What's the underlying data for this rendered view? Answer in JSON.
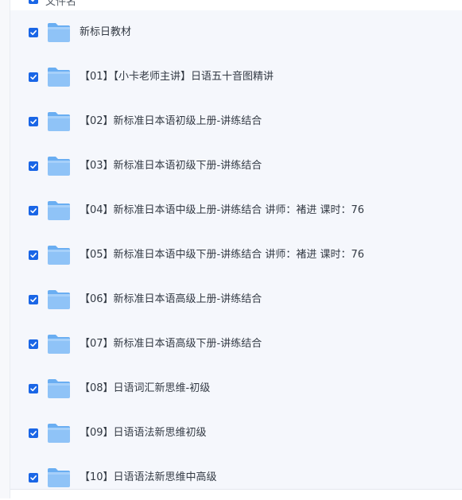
{
  "header": {
    "label": "文件名"
  },
  "files": [
    {
      "name": "新标日教材"
    },
    {
      "name": "【01】【小卡老师主讲】日语五十音图精讲"
    },
    {
      "name": "【02】新标准日本语初级上册-讲练结合"
    },
    {
      "name": "【03】新标准日本语初级下册-讲练结合"
    },
    {
      "name": "【04】新标准日本语中级上册-讲练结合 讲师：褚进 课时：76"
    },
    {
      "name": "【05】新标准日本语中级下册-讲练结合 讲师：褚进 课时：76"
    },
    {
      "name": "【06】新标准日本语高级上册-讲练结合"
    },
    {
      "name": "【07】新标准日本语高级下册-讲练结合"
    },
    {
      "name": "【08】日语词汇新思维-初级"
    },
    {
      "name": "【09】日语语法新思维初级"
    },
    {
      "name": "【10】日语语法新思维中高级"
    }
  ],
  "colors": {
    "checkbox": "#1a66e6",
    "folder": "#8fc3f7",
    "text": "#333a44"
  },
  "icons": {
    "row": "folder-icon",
    "select": "checkbox-checked-icon"
  }
}
